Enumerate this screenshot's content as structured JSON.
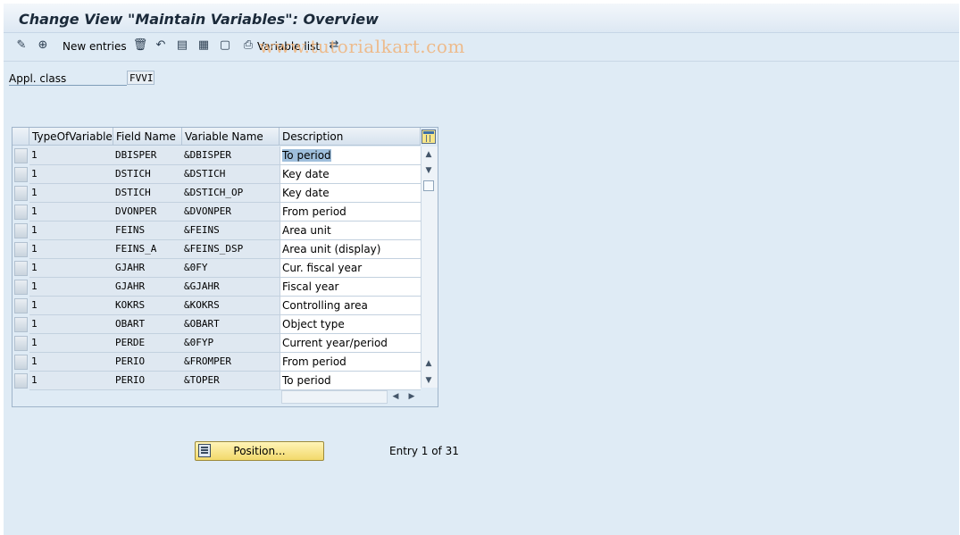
{
  "title": "Change View \"Maintain Variables\": Overview",
  "toolbar": {
    "new_entries_label": "New entries",
    "variable_list_label": "Variable list",
    "icons": [
      "change-display-icon",
      "details-icon",
      "delete-icon",
      "undo-icon",
      "select-all-icon",
      "select-block-icon",
      "deselect-all-icon",
      "print-icon",
      "export-icon"
    ]
  },
  "watermark": "www.tutorialkart.com",
  "appl_class": {
    "label": "Appl. class",
    "value": "FVVI"
  },
  "table": {
    "columns": [
      "TypeOfVariable",
      "Field Name",
      "Variable Name",
      "Description"
    ],
    "rows": [
      {
        "type": "1",
        "field": "DBISPER",
        "variable": "&DBISPER",
        "description": "To period"
      },
      {
        "type": "1",
        "field": "DSTICH",
        "variable": "&DSTICH",
        "description": "Key date"
      },
      {
        "type": "1",
        "field": "DSTICH",
        "variable": "&DSTICH_OP",
        "description": "Key date"
      },
      {
        "type": "1",
        "field": "DVONPER",
        "variable": "&DVONPER",
        "description": "From period"
      },
      {
        "type": "1",
        "field": "FEINS",
        "variable": "&FEINS",
        "description": "Area unit"
      },
      {
        "type": "1",
        "field": "FEINS_A",
        "variable": "&FEINS_DSP",
        "description": "Area unit (display)"
      },
      {
        "type": "1",
        "field": "GJAHR",
        "variable": "&0FY",
        "description": "Cur. fiscal year"
      },
      {
        "type": "1",
        "field": "GJAHR",
        "variable": "&GJAHR",
        "description": "Fiscal year"
      },
      {
        "type": "1",
        "field": "KOKRS",
        "variable": "&KOKRS",
        "description": "Controlling area"
      },
      {
        "type": "1",
        "field": "OBART",
        "variable": "&OBART",
        "description": "Object type"
      },
      {
        "type": "1",
        "field": "PERDE",
        "variable": "&0FYP",
        "description": "Current year/period"
      },
      {
        "type": "1",
        "field": "PERIO",
        "variable": "&FROMPER",
        "description": "From period"
      },
      {
        "type": "1",
        "field": "PERIO",
        "variable": "&TOPER",
        "description": "To period"
      }
    ]
  },
  "position_button_label": "Position...",
  "entry_info": "Entry 1 of 31"
}
